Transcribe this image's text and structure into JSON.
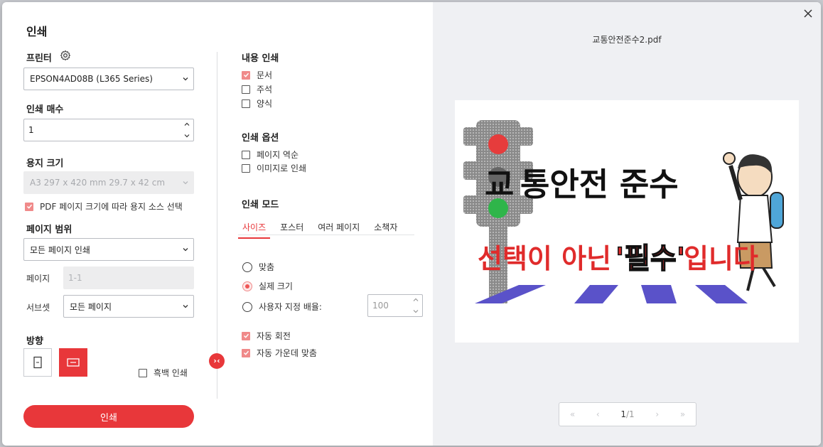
{
  "dialog": {
    "title": "인쇄"
  },
  "printer": {
    "label": "프린터",
    "value": "EPSON4AD08B (L365 Series)"
  },
  "copies": {
    "label": "인쇄 매수",
    "value": "1"
  },
  "paper": {
    "label": "용지 크기",
    "value": "A3 297 x 420 mm 29.7 x 42 cm",
    "auto_source_label": "PDF 페이지 크기에 따라 용지 소스 선택"
  },
  "range": {
    "label": "페이지 범위",
    "value": "모든 페이지 인쇄",
    "pages_label": "페이지",
    "pages_placeholder": "1-1",
    "subset_label": "서브셋",
    "subset_value": "모든 페이지"
  },
  "orientation": {
    "label": "방향",
    "grayscale_label": "흑백 인쇄"
  },
  "print_button": "인쇄",
  "content": {
    "label": "내용 인쇄",
    "items": [
      "문서",
      "주석",
      "양식"
    ]
  },
  "options": {
    "label": "인쇄 옵션",
    "items": [
      "페이지 역순",
      "이미지로 인쇄"
    ]
  },
  "mode": {
    "label": "인쇄 모드",
    "tabs": [
      "사이즈",
      "포스터",
      "여러 페이지",
      "소책자"
    ],
    "fit": "맞춤",
    "actual": "실제 크기",
    "custom": "사용자 지정 배율:",
    "custom_value": "100",
    "auto_rotate": "자동 회전",
    "auto_center": "자동 가운데 맞춤"
  },
  "preview": {
    "filename": "교통안전준수2.pdf",
    "headline_1": "교",
    "headline_2": "통안전 준수",
    "subline_1": "선택이 아닌 ",
    "subline_2": "'필수'",
    "subline_3": "입니다",
    "page_current": "1",
    "page_total": "/1"
  },
  "colors": {
    "accent": "#e8373a",
    "check": "#f08a8a"
  }
}
